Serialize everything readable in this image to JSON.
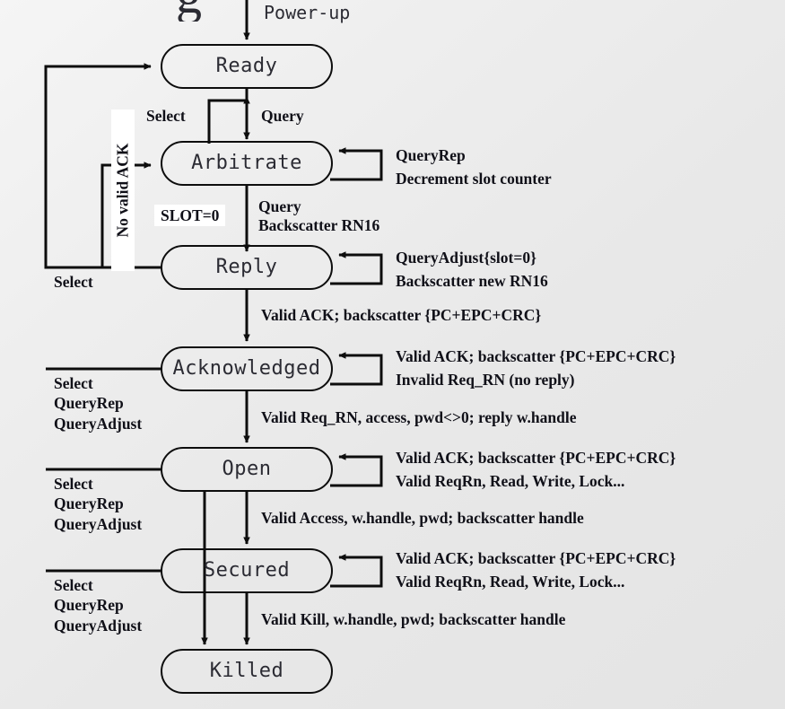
{
  "diagram": {
    "title_fragment": "g",
    "background_color": "#e9e9e9",
    "line_color": "#0d0d0d",
    "text_color": "#101018",
    "state_text_color": "#2b2b33",
    "highlight_box_color": "#ffffff"
  },
  "entry": {
    "label": "Power-up"
  },
  "states": [
    {
      "id": "ready",
      "label": "Ready"
    },
    {
      "id": "arbitrate",
      "label": "Arbitrate"
    },
    {
      "id": "reply",
      "label": "Reply"
    },
    {
      "id": "acknowledged",
      "label": "Acknowledged"
    },
    {
      "id": "open",
      "label": "Open"
    },
    {
      "id": "secured",
      "label": "Secured"
    },
    {
      "id": "killed",
      "label": "Killed"
    }
  ],
  "transitions": {
    "ready_to_arbitrate": "Query",
    "arbitrate_to_ready": "Select",
    "arbitrate_to_reply_line1": "Query",
    "arbitrate_to_reply_line2": "Backscatter RN16",
    "slot_zero": "SLOT=0",
    "no_valid_ack": "No valid ACK",
    "reply_to_acknowledged": "Valid ACK; backscatter {PC+EPC+CRC}",
    "acknowledged_to_open": "Valid Req_RN, access, pwd<>0; reply w.handle",
    "open_to_secured": "Valid Access, w.handle, pwd; backscatter handle",
    "secured_to_killed": "Valid Kill, w.handle, pwd; backscatter handle"
  },
  "self_loops": [
    {
      "state": "arbitrate",
      "line1": "QueryRep",
      "line2": "Decrement slot counter"
    },
    {
      "state": "reply",
      "line1": "QueryAdjust{slot=0}",
      "line2": "Backscatter new RN16"
    },
    {
      "state": "acknowledged",
      "line1": "Valid ACK; backscatter {PC+EPC+CRC}",
      "line2": "Invalid Req_RN (no reply)"
    },
    {
      "state": "open",
      "line1": "Valid ACK; backscatter {PC+EPC+CRC}",
      "line2": "Valid ReqRn, Read, Write, Lock..."
    },
    {
      "state": "secured",
      "line1": "Valid ACK; backscatter {PC+EPC+CRC}",
      "line2": "Valid ReqRn, Read, Write, Lock..."
    }
  ],
  "return_labels": [
    {
      "id": "reply-return",
      "lines": "Select"
    },
    {
      "id": "acknowledged-return",
      "lines": "Select\nQueryRep\nQueryAdjust"
    },
    {
      "id": "open-return",
      "lines": "Select\nQueryRep\nQueryAdjust"
    },
    {
      "id": "secured-return",
      "lines": "Select\nQueryRep\nQueryAdjust"
    }
  ]
}
